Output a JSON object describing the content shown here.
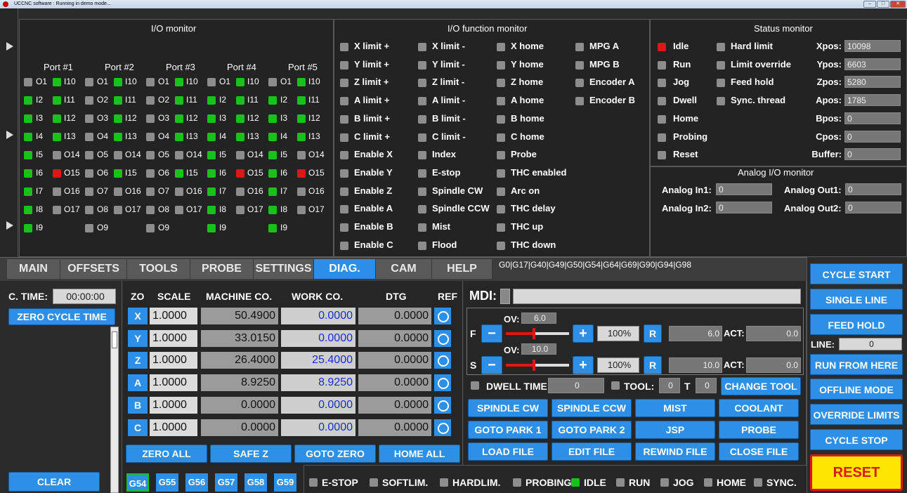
{
  "window": {
    "title": "UCCNC software : Running in demo mode..."
  },
  "io_monitor": {
    "title": "I/O monitor",
    "ports": [
      "Port #1",
      "Port #2",
      "Port #3",
      "Port #4",
      "Port #5"
    ],
    "port1": {
      "col1": [
        "O1",
        "I2",
        "I3",
        "I4",
        "I5",
        "I6",
        "I7",
        "I8",
        "I9"
      ],
      "col2": [
        "I10",
        "I11",
        "I12",
        "I13",
        "O14",
        "O15",
        "O16",
        "O17"
      ]
    },
    "port2": {
      "col1": [
        "O1",
        "O2",
        "O3",
        "O4",
        "O5",
        "O6",
        "O7",
        "O8",
        "O9"
      ],
      "col2": [
        "I10",
        "I11",
        "I12",
        "I13",
        "O14",
        "I15",
        "O16",
        "O17"
      ]
    },
    "port3": {
      "col1": [
        "O1",
        "O2",
        "O3",
        "O4",
        "O5",
        "O6",
        "O7",
        "O8",
        "O9"
      ],
      "col2": [
        "I10",
        "I11",
        "I12",
        "I13",
        "O14",
        "I15",
        "O16",
        "O17"
      ]
    },
    "port4": {
      "col1": [
        "O1",
        "I2",
        "I3",
        "I4",
        "I5",
        "I6",
        "I7",
        "I8",
        "I9"
      ],
      "col2": [
        "I10",
        "I11",
        "I12",
        "I13",
        "O14",
        "O15",
        "O16",
        "O17"
      ]
    },
    "port5": {
      "col1": [
        "O1",
        "I2",
        "I3",
        "I4",
        "I5",
        "I6",
        "I7",
        "I8",
        "I9"
      ],
      "col2": [
        "I10",
        "I11",
        "I12",
        "I13",
        "O14",
        "O15",
        "O16",
        "O17"
      ]
    }
  },
  "io_function_monitor": {
    "title": "I/O function monitor",
    "col1": [
      "X limit +",
      "Y limit +",
      "Z limit +",
      "A limit +",
      "B limit +",
      "C limit +",
      "Enable X",
      "Enable Y",
      "Enable Z",
      "Enable A",
      "Enable B",
      "Enable C"
    ],
    "col2": [
      "X limit -",
      "Y limit -",
      "Z limit -",
      "A limit -",
      "B limit -",
      "C limit -",
      "Index",
      "E-stop",
      "Spindle CW",
      "Spindle CCW",
      "Mist",
      "Flood"
    ],
    "col3": [
      "X home",
      "Y home",
      "Z home",
      "A home",
      "B home",
      "C home",
      "Probe",
      "THC enabled",
      "Arc on",
      "THC delay",
      "THC up",
      "THC down"
    ],
    "col4": [
      "MPG A",
      "MPG B",
      "Encoder A",
      "Encoder B"
    ]
  },
  "status_monitor": {
    "title": "Status monitor",
    "col1": [
      "Idle",
      "Run",
      "Jog",
      "Dwell",
      "Home",
      "Probing",
      "Reset"
    ],
    "col2": [
      "Hard limit",
      "Limit override",
      "Feed hold",
      "Sync. thread"
    ],
    "pos_labels": [
      "Xpos:",
      "Ypos:",
      "Zpos:",
      "Apos:",
      "Bpos:",
      "Cpos:",
      "Buffer:"
    ],
    "pos_values": [
      "10098",
      "6603",
      "5280",
      "1785",
      "0",
      "0",
      "0"
    ]
  },
  "analog_monitor": {
    "title": "Analog I/O monitor",
    "in1_label": "Analog In1:",
    "in1": "0",
    "in2_label": "Analog In2:",
    "in2": "0",
    "out1_label": "Analog Out1:",
    "out1": "0",
    "out2_label": "Analog Out2:",
    "out2": "0"
  },
  "tabs": [
    "MAIN",
    "OFFSETS",
    "TOOLS",
    "PROBE",
    "SETTINGS",
    "DIAG.",
    "CAM",
    "HELP"
  ],
  "gcodes": "G0|G17|G40|G49|G50|G54|G64|G69|G90|G94|G98",
  "cycle": {
    "label": "C. TIME:",
    "value": "00:00:00",
    "zero_btn": "ZERO CYCLE TIME",
    "clear_btn": "CLEAR"
  },
  "dro": {
    "headers": [
      "ZO",
      "SCALE",
      "MACHINE CO.",
      "WORK CO.",
      "DTG",
      "REF"
    ],
    "rows": [
      {
        "axis": "X",
        "scale": "1.0000",
        "machine": "50.4900",
        "work": "0.0000",
        "dtg": "0.0000"
      },
      {
        "axis": "Y",
        "scale": "1.0000",
        "machine": "33.0150",
        "work": "0.0000",
        "dtg": "0.0000"
      },
      {
        "axis": "Z",
        "scale": "1.0000",
        "machine": "26.4000",
        "work": "25.4000",
        "dtg": "0.0000"
      },
      {
        "axis": "A",
        "scale": "1.0000",
        "machine": "8.9250",
        "work": "8.9250",
        "dtg": "0.0000"
      },
      {
        "axis": "B",
        "scale": "1.0000",
        "machine": "0.0000",
        "work": "0.0000",
        "dtg": "0.0000"
      },
      {
        "axis": "C",
        "scale": "1.0000",
        "machine": "0.0000",
        "work": "0.0000",
        "dtg": "0.0000"
      }
    ],
    "buttons": [
      "ZERO ALL",
      "SAFE Z",
      "GOTO ZERO",
      "HOME ALL"
    ]
  },
  "offsets": [
    "G54",
    "G55",
    "G56",
    "G57",
    "G58",
    "G59"
  ],
  "mdi": {
    "label": "MDI:",
    "value": ""
  },
  "feed": {
    "ov_label": "OV:",
    "ov": "6.0",
    "letter": "F",
    "minus": "−",
    "plus": "+",
    "pct": "100%",
    "reset": "R",
    "value": "6.0",
    "act_label": "ACT:",
    "act": "0.0"
  },
  "spindle": {
    "ov_label": "OV:",
    "ov": "10.0",
    "letter": "S",
    "minus": "−",
    "plus": "+",
    "pct": "100%",
    "reset": "R",
    "value": "10.0",
    "act_label": "ACT:",
    "act": "0.0"
  },
  "dwell": {
    "label": "DWELL TIME:",
    "value": "0",
    "tool_label": "TOOL:",
    "tool": "0",
    "t_label": "T",
    "t": "0",
    "change_tool": "CHANGE TOOL"
  },
  "buttons_grid": [
    "SPINDLE CW",
    "SPINDLE CCW",
    "MIST",
    "COOLANT",
    "GOTO PARK 1",
    "GOTO PARK 2",
    "JSP",
    "PROBE",
    "LOAD FILE",
    "EDIT FILE",
    "REWIND FILE",
    "CLOSE FILE"
  ],
  "status_bar": [
    "E-STOP",
    "SOFTLIM.",
    "HARDLIM.",
    "PROBING",
    "IDLE",
    "RUN",
    "JOG",
    "HOME",
    "SYNC."
  ],
  "right_buttons": {
    "cycle_start": "CYCLE START",
    "single_line": "SINGLE LINE",
    "feed_hold": "FEED HOLD",
    "line_label": "LINE:",
    "line": "0",
    "run_from_here": "RUN FROM HERE",
    "offline": "OFFLINE MODE",
    "override": "OVERRIDE LIMITS",
    "cycle_stop": "CYCLE STOP",
    "reset": "RESET"
  },
  "colors": {
    "accent": "#2d8fe6",
    "led_on": "#19c11b",
    "led_off": "#8d8d8d",
    "led_alarm": "#e01515",
    "reset_bg": "#ffe500",
    "reset_text": "#e01515"
  }
}
